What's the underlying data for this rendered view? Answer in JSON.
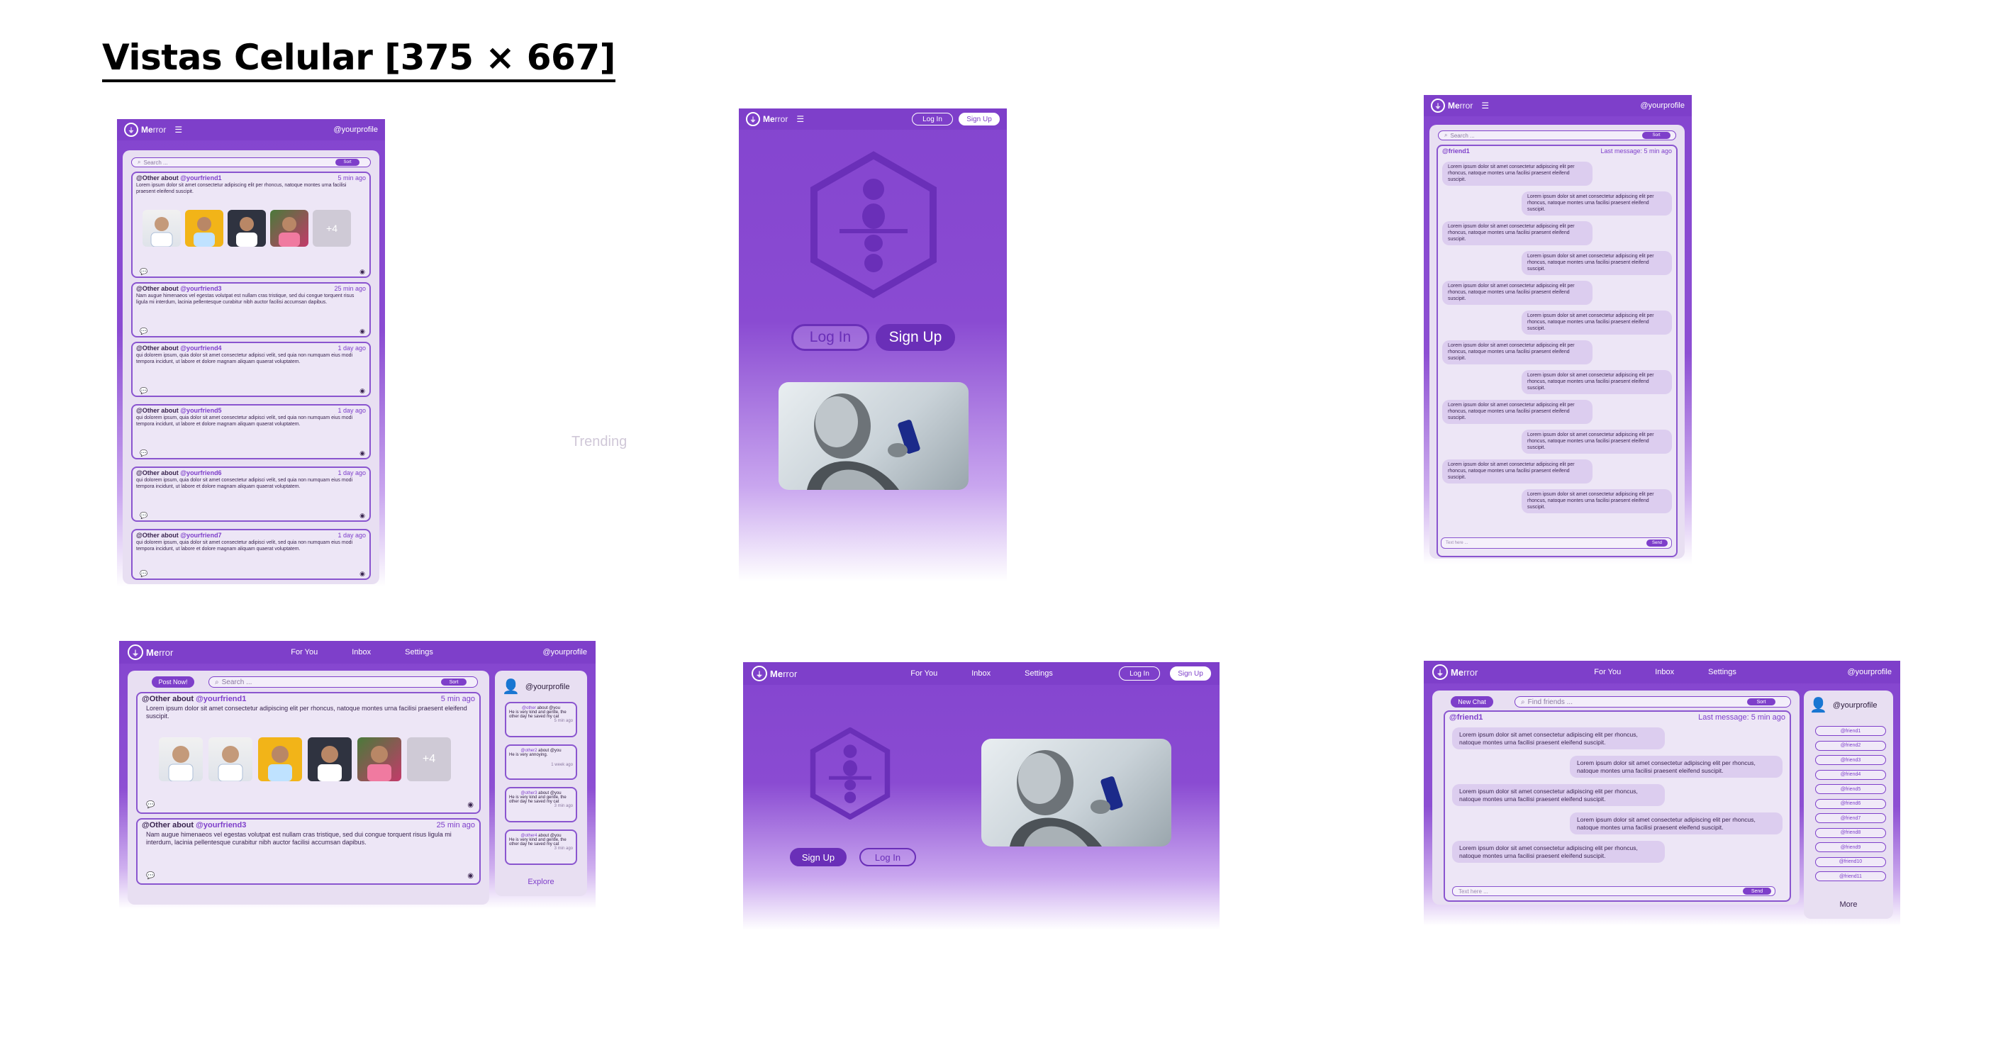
{
  "page": {
    "title": "Vistas Celular [375 × 667]",
    "trending": "Trending"
  },
  "brand": {
    "me": "Me",
    "rror": "rror"
  },
  "profile": "@yourprofile",
  "nav": {
    "for_you": "For You",
    "inbox": "Inbox",
    "settings": "Settings",
    "login": "Log In",
    "signup": "Sign Up"
  },
  "search": {
    "placeholder": "Search ...",
    "sort": "Sort",
    "find_friends": "Find friends ..."
  },
  "feed": {
    "posts": [
      {
        "prefix": "@Other about ",
        "friend": "@yourfriend1",
        "time": "5 min ago",
        "body": "Lorem ipsum dolor sit amet consectetur adipiscing elit per rhoncus, natoque montes urna facilisi praesent eleifend suscipit."
      },
      {
        "prefix": "@Other about ",
        "friend": "@yourfriend3",
        "time": "25 min ago",
        "body": "Nam augue himenaeos vel egestas volutpat est nullam cras tristique, sed dui congue torquent risus ligula mi interdum, lacinia pellentesque curabitur nibh auctor facilisi accumsan dapibus."
      },
      {
        "prefix": "@Other about ",
        "friend": "@yourfriend4",
        "time": "1 day ago",
        "body": "qui dolorem ipsum, quia dolor sit amet consectetur adipisci velit, sed quia non numquam eius modi tempora incidunt, ut labore et dolore magnam aliquam quaerat voluptatem."
      },
      {
        "prefix": "@Other about ",
        "friend": "@yourfriend5",
        "time": "1 day ago",
        "body": "qui dolorem ipsum, quia dolor sit amet consectetur adipisci velit, sed quia non numquam eius modi tempora incidunt, ut labore et dolore magnam aliquam quaerat voluptatem."
      },
      {
        "prefix": "@Other about ",
        "friend": "@yourfriend6",
        "time": "1 day ago",
        "body": "qui dolorem ipsum, quia dolor sit amet consectetur adipisci velit, sed quia non numquam eius modi tempora incidunt, ut labore et dolore magnam aliquam quaerat voluptatem."
      },
      {
        "prefix": "@Other about ",
        "friend": "@yourfriend7",
        "time": "1 day ago",
        "body": "qui dolorem ipsum, quia dolor sit amet consectetur adipisci velit, sed quia non numquam eius modi tempora incidunt, ut labore et dolore magnam aliquam quaerat voluptatem."
      }
    ],
    "more_photos": "+4",
    "post_now": "Post Now!"
  },
  "chat": {
    "friend": "@friend1",
    "last_message": "Last message: 5 min ago",
    "message": "Lorem ipsum dolor sit amet consectetur adipiscing elit per rhoncus, natoque montes urna facilisi praesent eleifend suscipit.",
    "input_placeholder": "Text here ...",
    "send": "Send",
    "new_chat": "New Chat",
    "friends": [
      "@friend1",
      "@friend2",
      "@friend3",
      "@friend4",
      "@friend5",
      "@friend6",
      "@friend7",
      "@friend8",
      "@friend9",
      "@friend10",
      "@friend11"
    ],
    "more": "More"
  },
  "sidebar_notes": [
    {
      "who": "@other",
      "about": "about @you",
      "text": "He is very kind and gentle, the other day he saved my cat",
      "time": "5 min ago"
    },
    {
      "who": "@other2",
      "about": "about @you",
      "text": "He is very annoying.",
      "time": "1 week ago"
    },
    {
      "who": "@other3",
      "about": "about @you",
      "text": "He is very kind and gentle, the other day he saved my cat",
      "time": "3 min ago"
    },
    {
      "who": "@other4",
      "about": "about @you",
      "text": "He is very kind and gentle, the other day he saved my cat",
      "time": "3 min ago"
    }
  ],
  "explore": "Explore",
  "colors": {
    "brand": "#7e3fca",
    "panel": "#e8dff2",
    "bubble": "#dccdef"
  }
}
